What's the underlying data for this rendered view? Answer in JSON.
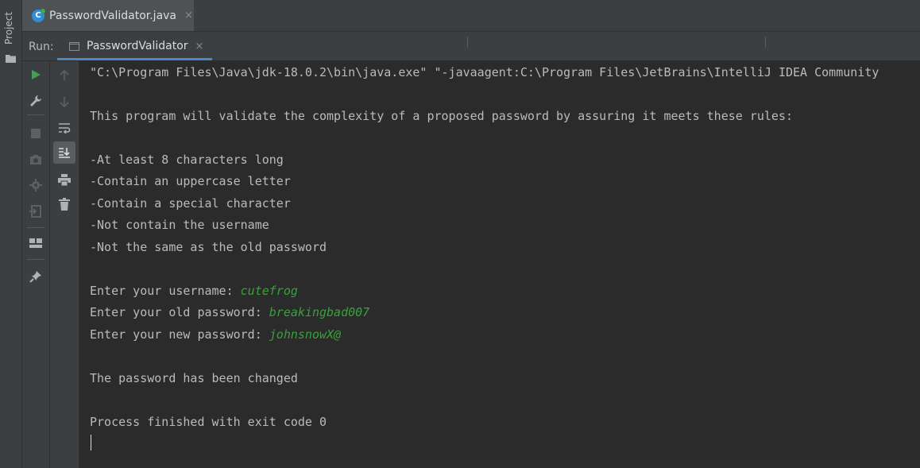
{
  "left_strip": {
    "project_label": "Project"
  },
  "editor_tab": {
    "label": "PasswordValidator.java",
    "icon": "java-class-icon",
    "close": "×"
  },
  "run_window": {
    "run_label": "Run:",
    "tab_label": "PasswordValidator",
    "tab_close": "×",
    "accent": "#4a88c7"
  },
  "toolbar_left": [
    "rerun-icon",
    "wrench-icon",
    "stop-icon",
    "camera-icon",
    "settings-gear-icon",
    "exit-icon",
    "layout-icon",
    "pin-icon"
  ],
  "toolbar_right": [
    "up-arrow-icon",
    "down-arrow-icon",
    "soft-wrap-icon",
    "scroll-to-end-icon",
    "print-icon",
    "trash-icon"
  ],
  "console": {
    "line1": "\"C:\\Program Files\\Java\\jdk-18.0.2\\bin\\java.exe\" \"-javaagent:C:\\Program Files\\JetBrains\\IntelliJ IDEA Community",
    "intro": "This program will validate the complexity of a proposed password by assuring it meets these rules:",
    "rules": [
      "-At least 8 characters long",
      "-Contain an uppercase letter",
      "-Contain a special character",
      "-Not contain the username",
      "-Not the same as the old password"
    ],
    "prompt_username": "Enter your username: ",
    "value_username": "cutefrog",
    "prompt_old": "Enter your old password: ",
    "value_old": "breakingbad007",
    "prompt_new": "Enter your new password: ",
    "value_new": "johnsnowX@",
    "result": "The password has been changed",
    "exit": "Process finished with exit code 0",
    "input_color": "#38a23a"
  }
}
